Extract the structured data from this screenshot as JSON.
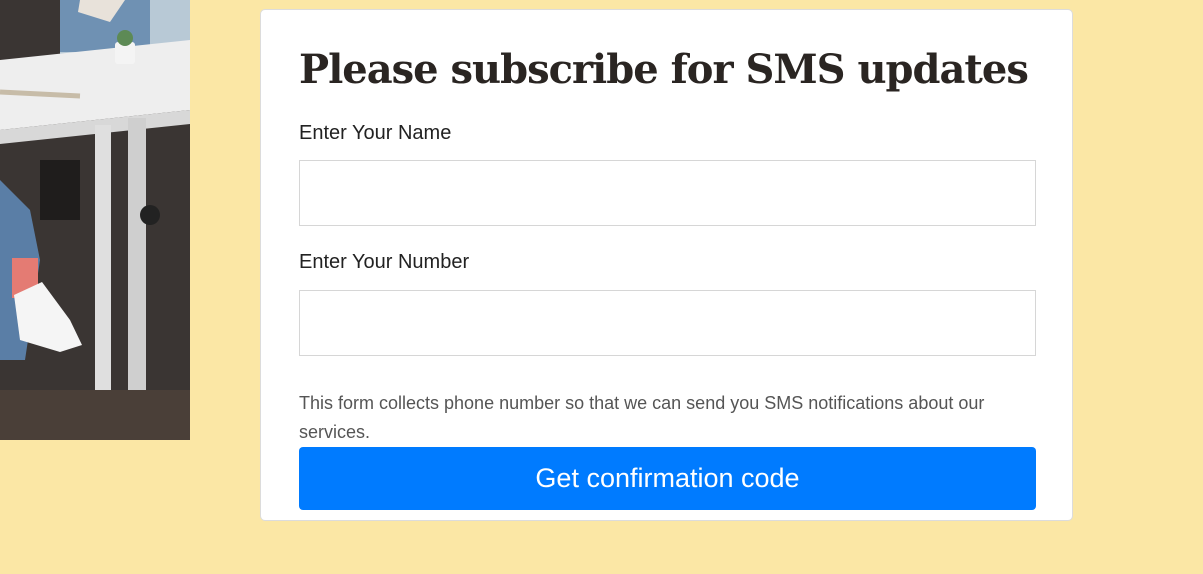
{
  "form": {
    "title": "Please subscribe for SMS updates",
    "name_label": "Enter Your Name",
    "name_value": "",
    "number_label": "Enter Your Number",
    "number_value": "",
    "notice": "This form collects phone number so that we can send you SMS notifications about our services.",
    "submit_label": "Get confirmation code"
  },
  "colors": {
    "page_background": "#fbe7a5",
    "button": "#007bff"
  }
}
